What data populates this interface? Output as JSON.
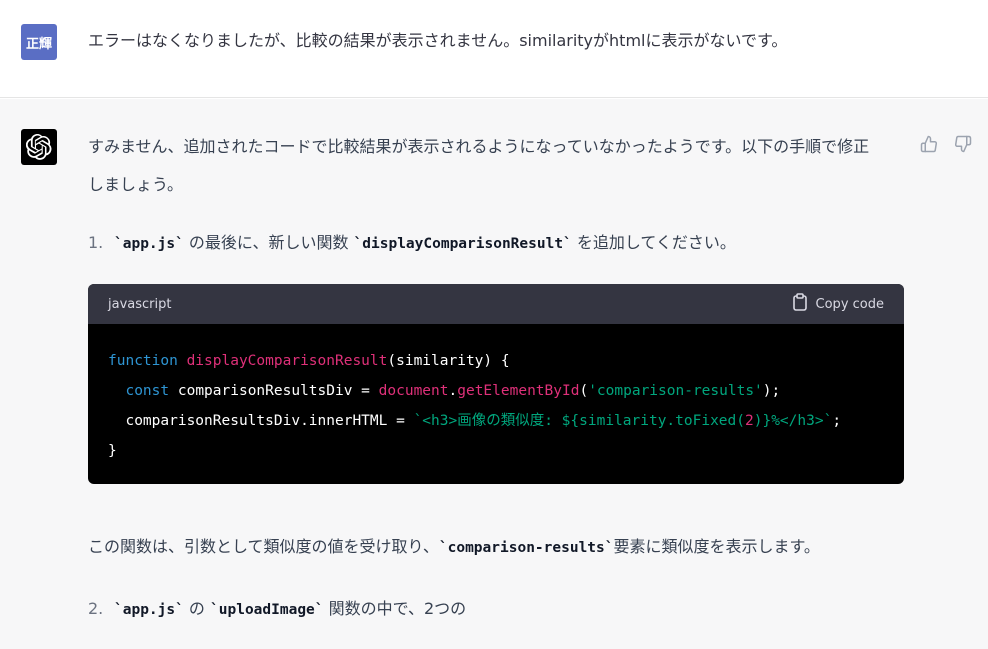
{
  "user_message": {
    "avatar_text": "正輝",
    "text": "エラーはなくなりましたが、比較の結果が表示されません。similarityがhtmlに表示がないです。",
    "avatar_color": "#5a6ec4"
  },
  "assistant_message": {
    "avatar_icon": "openai-logo-icon",
    "intro_line1": "すみません、追加されたコードで比較結果が表示されるようになっていなかったようです。以下の手順で修正",
    "intro_line2": "しましょう。",
    "step1": {
      "number": "1.",
      "code_file": "`app.js`",
      "text_mid": " の最後に、新しい関数 ",
      "code_fn": "`displayComparisonResult`",
      "text_end": " を追加してください。"
    },
    "code_block": {
      "language": "javascript",
      "copy_label": "Copy code",
      "lines": [
        {
          "kw": "function ",
          "fn": "displayComparisonResult",
          "rest": "(similarity) {"
        },
        {
          "indent": "  ",
          "kw": "const ",
          "plain": "comparisonResultsDiv = ",
          "dc": "document",
          "dot": ".",
          "fn": "getElementById",
          "open": "(",
          "str": "'comparison-results'",
          "close": ");"
        },
        {
          "indent": "  ",
          "plain": "comparisonResultsDiv.innerHTML = ",
          "str_a": "`<h3>画像の類似度: ${similarity.toFixed(",
          "num": "2",
          "str_b": ")}%</h3>`",
          "end": ";"
        },
        {
          "plain": "}"
        }
      ]
    },
    "para_after": {
      "text_start": "この関数は、引数として類似度の値を受け取り、",
      "code": "`comparison-results`",
      "text_end": "要素に類似度を表示します。"
    },
    "step2": {
      "number": "2.",
      "code_file": "`app.js`",
      "text_mid": " の ",
      "code_fn": "`uploadImage`",
      "text_end": " 関数の中で、2つの"
    }
  },
  "colors": {
    "keyword": "#2e95d3",
    "function": "#df3079",
    "string": "#00a67d",
    "bot_bg": "#f7f7f8",
    "code_header_bg": "#343541"
  }
}
